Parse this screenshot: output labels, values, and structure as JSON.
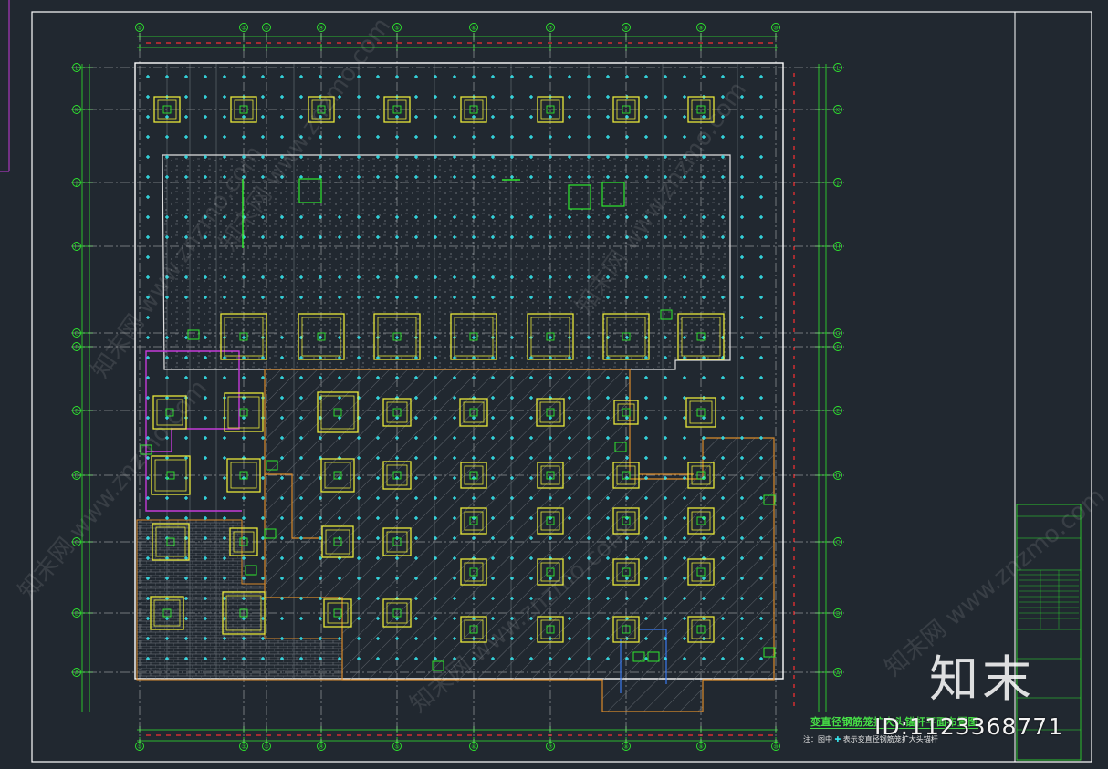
{
  "drawing": {
    "title": "变直径钢筋笼扩大头锚杆平面布置图",
    "note_prefix": "注：图中",
    "note_body": "表示变直径钢筋笼扩大头锚杆",
    "grid_columns": [
      "①",
      "②",
      "③",
      "④",
      "⑤",
      "⑥",
      "⑦",
      "⑧",
      "⑨"
    ],
    "grid_rows": [
      "L",
      "K",
      "J",
      "H",
      "G",
      "F",
      "E",
      "D",
      "C",
      "B",
      "A"
    ]
  },
  "watermark": {
    "logo_text": "知末",
    "id_text": "ID:1123368771",
    "site_text": "知末网 www.znzmo.com"
  },
  "colors": {
    "background": "#212830",
    "grid_line": "#c8c8c8",
    "dimension": "#2ee82e",
    "red_marks": "#ff3030",
    "anchor": "#37e8f0",
    "pile_cap": "#e8e83a",
    "outline": "#ffffff",
    "frame": "#ffffff",
    "hatch": "#8a8f96",
    "orange": "#d98a2b",
    "magenta": "#c43ad8"
  }
}
